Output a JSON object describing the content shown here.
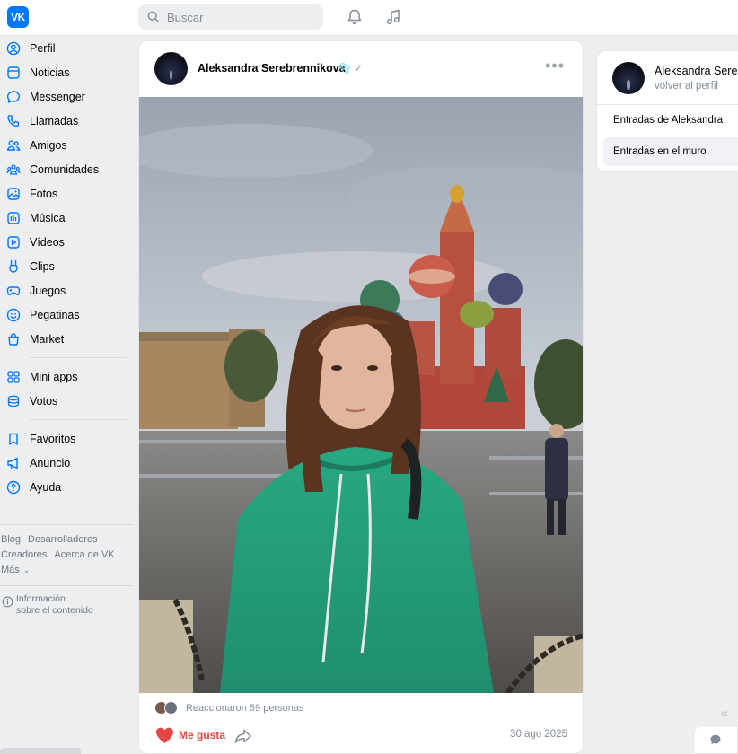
{
  "header": {
    "logo_text": "VK",
    "search_placeholder": "Buscar",
    "icons": [
      "bell-icon",
      "music-icon"
    ]
  },
  "sidebar": {
    "items": [
      {
        "label": "Perfil",
        "icon": "user-icon"
      },
      {
        "label": "Noticias",
        "icon": "newspaper-icon"
      },
      {
        "label": "Messenger",
        "icon": "chat-bubble-icon"
      },
      {
        "label": "Llamadas",
        "icon": "phone-icon"
      },
      {
        "label": "Amigos",
        "icon": "friends-icon"
      },
      {
        "label": "Comunidades",
        "icon": "communities-icon"
      },
      {
        "label": "Fotos",
        "icon": "photo-icon"
      },
      {
        "label": "Música",
        "icon": "music-bars-icon"
      },
      {
        "label": "Vídeos",
        "icon": "video-icon"
      },
      {
        "label": "Clips",
        "icon": "clips-icon"
      },
      {
        "label": "Juegos",
        "icon": "gamepad-icon"
      },
      {
        "label": "Pegatinas",
        "icon": "sticker-icon"
      },
      {
        "label": "Market",
        "icon": "bag-icon"
      },
      {
        "label": "Mini apps",
        "icon": "apps-grid-icon"
      },
      {
        "label": "Votos",
        "icon": "coins-icon"
      },
      {
        "label": "Favoritos",
        "icon": "bookmark-icon"
      },
      {
        "label": "Anuncio",
        "icon": "megaphone-icon"
      },
      {
        "label": "Ayuda",
        "icon": "help-icon"
      }
    ],
    "footer_links": [
      "Blog",
      "Desarrolladores",
      "Creadores",
      "Acerca de VK",
      "Más"
    ],
    "info_line1": "Información",
    "info_line2": "sobre el contenido"
  },
  "post": {
    "author": "Aleksandra Serebrennikova",
    "author_emoji": "🫧",
    "verified_mark": "✓",
    "more": "•••",
    "reactions_text": "Reaccionaron 59 personas",
    "like_label": "Me gusta",
    "date": "30 ago 2025"
  },
  "right_panel": {
    "name": "Aleksandra Serebrennikova",
    "back_link": "volver al perfil",
    "links": [
      "Entradas de Aleksandra",
      "Entradas en el muro"
    ],
    "active_link_index": 1
  },
  "colors": {
    "accent": "#0077ff",
    "like": "#e64646",
    "muted": "#818c99",
    "background": "#edeef0"
  }
}
